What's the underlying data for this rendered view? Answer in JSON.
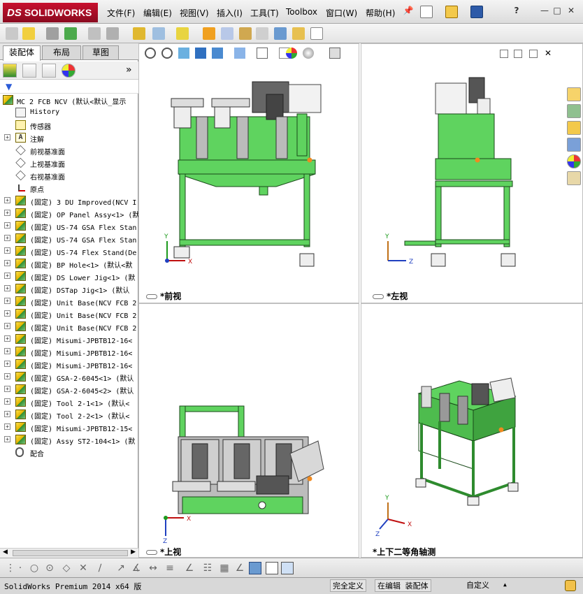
{
  "app": {
    "logo_prefix": "DS",
    "logo_text": "SOLIDWORKS"
  },
  "menu": {
    "items": [
      "文件(F)",
      "编辑(E)",
      "视图(V)",
      "插入(I)",
      "工具(T)",
      "Toolbox",
      "窗口(W)",
      "帮助(H)"
    ],
    "help_glyph": "?"
  },
  "left_panel": {
    "tabs": [
      "装配体",
      "布局",
      "草图"
    ],
    "more_glyph": "»",
    "tree": [
      {
        "label": "MC 2 FCB NCV  (默认<默认_显示",
        "icon": "assembly-icon",
        "expander": false
      },
      {
        "label": "History",
        "icon": "history-icon",
        "expander": false
      },
      {
        "label": "传感器",
        "icon": "sensor-icon",
        "expander": false
      },
      {
        "label": "注解",
        "icon": "annotation-icon",
        "expander": true
      },
      {
        "label": "前视基准面",
        "icon": "plane-icon",
        "expander": false
      },
      {
        "label": "上视基准面",
        "icon": "plane-icon",
        "expander": false
      },
      {
        "label": "右视基准面",
        "icon": "plane-icon",
        "expander": false
      },
      {
        "label": "原点",
        "icon": "origin-icon",
        "expander": false
      },
      {
        "label": "(固定) 3 DU Improved(NCV I",
        "icon": "subassembly-icon",
        "expander": true
      },
      {
        "label": "(固定) OP Panel Assy<1> (默",
        "icon": "subassembly-icon",
        "expander": true
      },
      {
        "label": "(固定) US-74 GSA Flex Stan",
        "icon": "subassembly-icon",
        "expander": true
      },
      {
        "label": "(固定) US-74 GSA Flex Stan",
        "icon": "subassembly-icon",
        "expander": true
      },
      {
        "label": "(固定) US-74 Flex Stand(De",
        "icon": "subassembly-icon",
        "expander": true
      },
      {
        "label": "(固定) BP Hole<1> (默认<默",
        "icon": "subassembly-icon",
        "expander": true
      },
      {
        "label": "(固定) DS Lower Jig<1> (默",
        "icon": "subassembly-icon",
        "expander": true
      },
      {
        "label": "(固定) DSTap Jig<1> (默认",
        "icon": "subassembly-icon",
        "expander": true
      },
      {
        "label": "(固定) Unit Base(NCV FCB 2",
        "icon": "part-icon",
        "expander": true
      },
      {
        "label": "(固定) Unit Base(NCV FCB 2",
        "icon": "part-icon",
        "expander": true
      },
      {
        "label": "(固定) Unit Base(NCV FCB 2",
        "icon": "part-icon",
        "expander": true
      },
      {
        "label": "(固定) Misumi-JPBTB12-16<",
        "icon": "part-icon",
        "expander": true
      },
      {
        "label": "(固定) Misumi-JPBTB12-16<",
        "icon": "part-icon",
        "expander": true
      },
      {
        "label": "(固定) Misumi-JPBTB12-16<",
        "icon": "part-icon",
        "expander": true
      },
      {
        "label": "(固定) GSA-2-6045<1> (默认",
        "icon": "part-icon",
        "expander": true
      },
      {
        "label": "(固定) GSA-2-6045<2> (默认",
        "icon": "part-icon",
        "expander": true
      },
      {
        "label": "(固定) Tool 2-1<1> (默认<",
        "icon": "part-icon",
        "expander": true
      },
      {
        "label": "(固定) Tool 2-2<1> (默认<",
        "icon": "part-icon",
        "expander": true
      },
      {
        "label": "(固定) Misumi-JPBTB12-15<",
        "icon": "part-icon",
        "expander": true
      },
      {
        "label": "(固定) Assy ST2-104<1> (默",
        "icon": "subassembly-icon",
        "expander": true
      },
      {
        "label": "配合",
        "icon": "mates-icon",
        "expander": false
      }
    ]
  },
  "viewports": [
    {
      "id": "front",
      "label": "*前视",
      "triad": [
        "Y",
        "X"
      ]
    },
    {
      "id": "left",
      "label": "*左视",
      "triad": [
        "Y",
        "Z"
      ]
    },
    {
      "id": "top",
      "label": "*上视",
      "triad": [
        "X",
        "Z"
      ]
    },
    {
      "id": "iso",
      "label": "*上下二等角轴测",
      "triad": [
        "Y",
        "X",
        "Z"
      ]
    }
  ],
  "status_bar": {
    "product": "SolidWorks Premium 2014 x64 版",
    "definition": "完全定义",
    "editing": "在编辑 装配体",
    "custom": "自定义",
    "custom_arrow": "▲"
  },
  "colors": {
    "machine_green": "#5fd35f",
    "frame_edge": "#1a4a1a",
    "accent_red": "#c8102e"
  }
}
